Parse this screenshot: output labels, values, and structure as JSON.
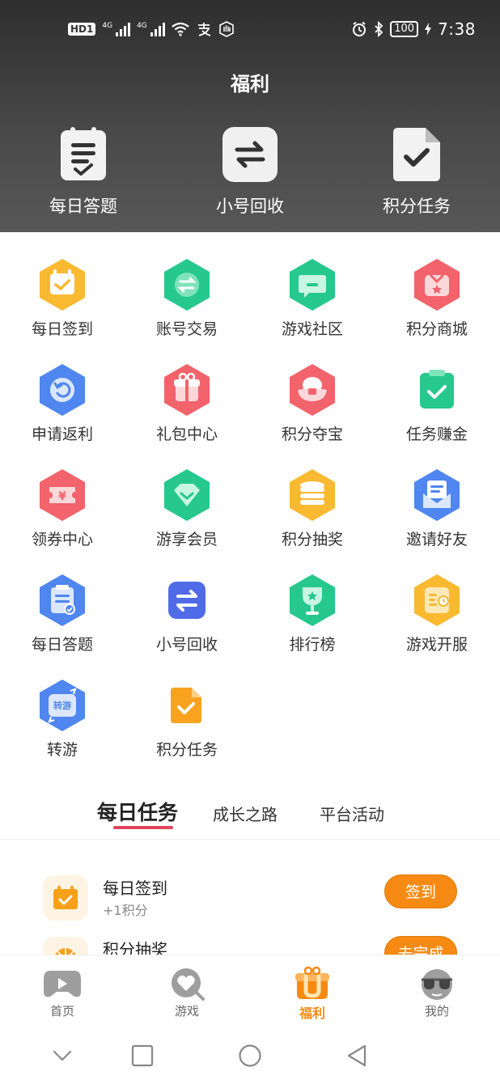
{
  "status_bar": {
    "hd": "HD",
    "hd_sub": "1",
    "net1": "4G",
    "net2": "4G",
    "battery": "100",
    "time": "7:38"
  },
  "header": {
    "title": "福利",
    "quick_actions": [
      {
        "label": "每日答题",
        "icon": "answer-list-icon"
      },
      {
        "label": "小号回收",
        "icon": "exchange-icon"
      },
      {
        "label": "积分任务",
        "icon": "document-check-icon"
      }
    ]
  },
  "grid": [
    {
      "label": "每日签到",
      "icon": "calendar-check-icon",
      "color": "#f9b931"
    },
    {
      "label": "账号交易",
      "icon": "swap-icon",
      "color": "#26c88e"
    },
    {
      "label": "游戏社区",
      "icon": "chat-bubble-icon",
      "color": "#26c88e"
    },
    {
      "label": "积分商城",
      "icon": "shop-bag-icon",
      "color": "#f2636b"
    },
    {
      "label": "申请返利",
      "icon": "refresh-icon",
      "color": "#4f86ef"
    },
    {
      "label": "礼包中心",
      "icon": "gift-icon",
      "color": "#f2636b"
    },
    {
      "label": "积分夺宝",
      "icon": "treasure-icon",
      "color": "#f2636b"
    },
    {
      "label": "任务赚金",
      "icon": "clipboard-check-icon",
      "color": "#26c88e"
    },
    {
      "label": "领券中心",
      "icon": "coupon-icon",
      "color": "#f2636b"
    },
    {
      "label": "游享会员",
      "icon": "diamond-icon",
      "color": "#26c88e"
    },
    {
      "label": "积分抽奖",
      "icon": "coin-stack-icon",
      "color": "#f9b931"
    },
    {
      "label": "邀请好友",
      "icon": "invite-mail-icon",
      "color": "#4f86ef"
    },
    {
      "label": "每日答题",
      "icon": "answer-doc-icon",
      "color": "#4f86ef"
    },
    {
      "label": "小号回收",
      "icon": "exchange-icon",
      "color": "#4f6be8"
    },
    {
      "label": "排行榜",
      "icon": "trophy-icon",
      "color": "#26c88e"
    },
    {
      "label": "游戏开服",
      "icon": "server-open-icon",
      "color": "#f9b931"
    },
    {
      "label": "转游",
      "icon": "transfer-game-icon",
      "color": "#4f86ef",
      "badge": "转游"
    },
    {
      "label": "积分任务",
      "icon": "document-check-icon",
      "color": "#f9a220"
    }
  ],
  "tabs": [
    {
      "label": "每日任务",
      "active": true
    },
    {
      "label": "成长之路",
      "active": false
    },
    {
      "label": "平台活动",
      "active": false
    }
  ],
  "tasks": [
    {
      "name": "每日签到",
      "sub": "+1积分",
      "button": "签到",
      "icon": "calendar-check-icon"
    },
    {
      "name": "积分抽奖",
      "sub": "",
      "button": "去完成",
      "icon": "lottery-icon"
    }
  ],
  "bottom_nav": [
    {
      "label": "首页",
      "icon": "gamepad-icon",
      "active": false
    },
    {
      "label": "游戏",
      "icon": "heart-search-icon",
      "active": false
    },
    {
      "label": "福利",
      "icon": "gift-box-icon",
      "active": true
    },
    {
      "label": "我的",
      "icon": "sunglasses-face-icon",
      "active": false
    }
  ],
  "colors": {
    "accent": "#f78a12",
    "tab_underline": "#e0455a",
    "header_bg": "#3d3d3d"
  }
}
